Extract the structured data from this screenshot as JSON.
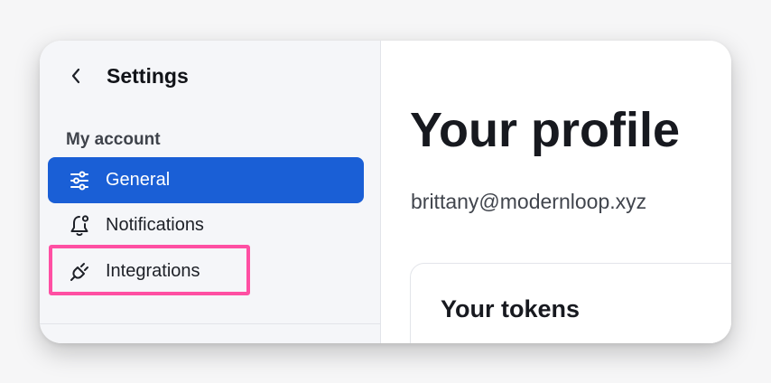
{
  "colors": {
    "accent": "#1a5fd6",
    "highlight": "#ff4fa3",
    "sidebar_bg": "#f5f6f9"
  },
  "sidebar": {
    "back_icon": "chevron-left-icon",
    "title": "Settings",
    "section_label": "My account",
    "items": [
      {
        "label": "General",
        "icon": "sliders-icon",
        "active": true
      },
      {
        "label": "Notifications",
        "icon": "bell-icon",
        "active": false
      },
      {
        "label": "Integrations",
        "icon": "plug-icon",
        "active": false
      }
    ]
  },
  "main": {
    "title": "Your profile",
    "email": "brittany@modernloop.xyz",
    "tokens_card": {
      "title": "Your tokens"
    }
  }
}
